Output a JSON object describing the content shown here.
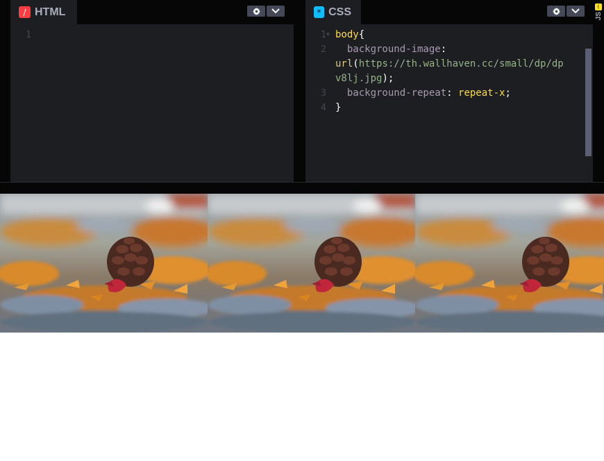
{
  "html_panel": {
    "title": "HTML",
    "badge_glyph": "/",
    "line_numbers": [
      "1"
    ]
  },
  "css_panel": {
    "title": "CSS",
    "badge_glyph": "*",
    "line_numbers": [
      "1",
      "2",
      "",
      "3",
      "4"
    ],
    "code": {
      "l1_selector": "body",
      "l1_brace": "{",
      "l2_indent": "  ",
      "l2_prop": "background-image",
      "l2_colon": ":",
      "l3_fn": "url",
      "l3_paren_open": "(",
      "l3_url": "https://th.wallhaven.cc/small/dp/dp",
      "l4_url": "v8lj.jpg",
      "l4_close": ");",
      "l5_indent": "  ",
      "l5_prop": "background-repeat",
      "l5_colon": ": ",
      "l5_val": "repeat-x",
      "l5_semi": ";",
      "l6_brace": "}"
    }
  },
  "js_panel": {
    "title": "JS",
    "badge_glyph": "("
  },
  "icons": {
    "settings": "gear-icon",
    "collapse": "chevron-down-icon"
  },
  "colors": {
    "html_badge": "#ff3c41",
    "css_badge": "#0ebeff",
    "js_badge": "#ffe21f"
  },
  "preview": {
    "background_repeat": "repeat-x",
    "tile_count_visible": 3
  }
}
